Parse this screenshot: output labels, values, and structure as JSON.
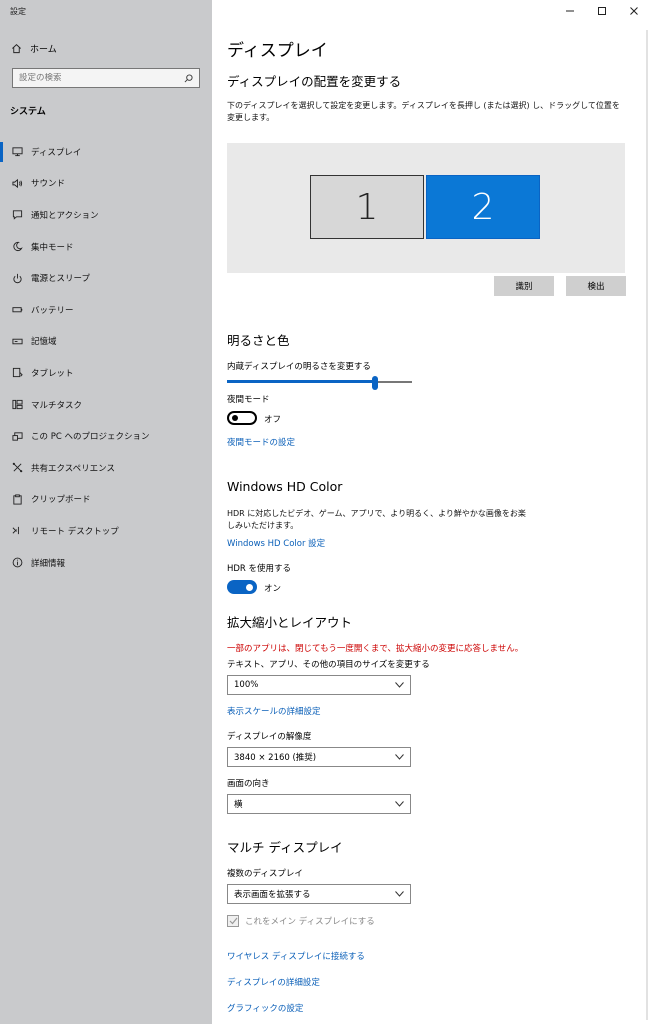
{
  "app": {
    "title": "設定"
  },
  "sidebar": {
    "home_label": "ホーム",
    "search_placeholder": "設定の検索",
    "section_label": "システム",
    "items": [
      {
        "label": "ディスプレイ",
        "icon": "monitor-icon"
      },
      {
        "label": "サウンド",
        "icon": "speaker-icon"
      },
      {
        "label": "通知とアクション",
        "icon": "notification-icon"
      },
      {
        "label": "集中モード",
        "icon": "moon-icon"
      },
      {
        "label": "電源とスリープ",
        "icon": "power-icon"
      },
      {
        "label": "バッテリー",
        "icon": "battery-icon"
      },
      {
        "label": "記憶域",
        "icon": "storage-icon"
      },
      {
        "label": "タブレット",
        "icon": "tablet-icon"
      },
      {
        "label": "マルチタスク",
        "icon": "multitask-icon"
      },
      {
        "label": "この PC へのプロジェクション",
        "icon": "projection-icon"
      },
      {
        "label": "共有エクスペリエンス",
        "icon": "share-icon"
      },
      {
        "label": "クリップボード",
        "icon": "clipboard-icon"
      },
      {
        "label": "リモート デスクトップ",
        "icon": "remote-icon"
      },
      {
        "label": "詳細情報",
        "icon": "info-icon"
      }
    ]
  },
  "main": {
    "page_title": "ディスプレイ",
    "arrange": {
      "heading": "ディスプレイの配置を変更する",
      "description": "下のディスプレイを選択して設定を変更します。ディスプレイを長押し (または選択) し、ドラッグして位置を変更します。",
      "monitor1": "1",
      "monitor2": "2",
      "identify_label": "識別",
      "detect_label": "検出"
    },
    "brightness": {
      "heading": "明るさと色",
      "slider_label": "内蔵ディスプレイの明るさを変更する",
      "slider_value": 0.8,
      "night_label": "夜間モード",
      "night_state": "オフ",
      "night_link": "夜間モードの設定"
    },
    "hdr": {
      "heading": "Windows HD Color",
      "description": "HDR に対応したビデオ、ゲーム、アプリで、より明るく、より鮮やかな画像をお楽しみいただけます。",
      "link": "Windows HD Color 設定",
      "use_label": "HDR を使用する",
      "use_state": "オン"
    },
    "scale": {
      "heading": "拡大縮小とレイアウト",
      "warning": "一部のアプリは、閉じてもう一度開くまで、拡大縮小の変更に応答しません。",
      "size_label": "テキスト、アプリ、その他の項目のサイズを変更する",
      "size_value": "100%",
      "advanced_link": "表示スケールの詳細設定",
      "resolution_label": "ディスプレイの解像度",
      "resolution_value": "3840 × 2160 (推奨)",
      "orientation_label": "画面の向き",
      "orientation_value": "横"
    },
    "multi": {
      "heading": "マルチ ディスプレイ",
      "multi_label": "複数のディスプレイ",
      "multi_value": "表示画面を拡張する",
      "main_checkbox": "これをメイン ディスプレイにする",
      "wireless_link": "ワイヤレス ディスプレイに接続する",
      "advanced_link": "ディスプレイの詳細設定",
      "graphics_link": "グラフィックの設定"
    }
  }
}
